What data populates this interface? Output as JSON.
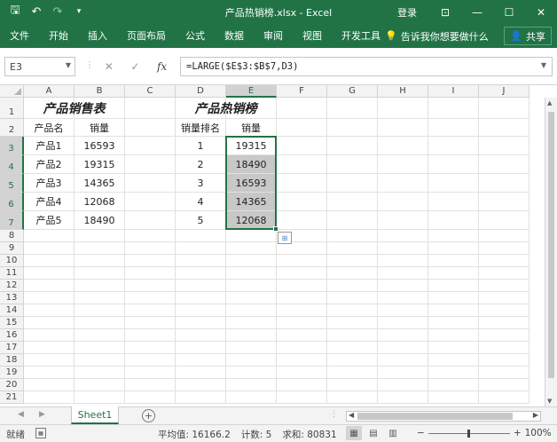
{
  "titlebar": {
    "title": "产品热销榜.xlsx - Excel",
    "login": "登录",
    "icons": [
      "save-icon",
      "undo-icon",
      "redo-icon",
      "customize-icon"
    ]
  },
  "ribbon": {
    "tabs": [
      "文件",
      "开始",
      "插入",
      "页面布局",
      "公式",
      "数据",
      "审阅",
      "视图",
      "开发工具"
    ],
    "tellme": "告诉我你想要做什么",
    "share": "共享"
  },
  "formula_bar": {
    "name_box": "E3",
    "formula": "=LARGE($E$3:$B$7,D3)"
  },
  "columns": [
    "A",
    "B",
    "C",
    "D",
    "E",
    "F",
    "G",
    "H",
    "I",
    "J"
  ],
  "rows": [
    "1",
    "2",
    "3",
    "4",
    "5",
    "6",
    "7",
    "8",
    "9",
    "10",
    "11",
    "12",
    "13",
    "14",
    "15",
    "16",
    "17",
    "18",
    "19",
    "20",
    "21"
  ],
  "sheet": {
    "left_title": "产品销售表",
    "right_title": "产品热销榜",
    "left_headers": [
      "产品名",
      "销量"
    ],
    "right_headers": [
      "销量排名",
      "销量"
    ],
    "left_rows": [
      [
        "产品1",
        "16593"
      ],
      [
        "产品2",
        "19315"
      ],
      [
        "产品3",
        "14365"
      ],
      [
        "产品4",
        "12068"
      ],
      [
        "产品5",
        "18490"
      ]
    ],
    "right_rows": [
      [
        "1",
        "19315"
      ],
      [
        "2",
        "18490"
      ],
      [
        "3",
        "16593"
      ],
      [
        "4",
        "14365"
      ],
      [
        "5",
        "12068"
      ]
    ]
  },
  "sheet_tabs": {
    "active": "Sheet1"
  },
  "statusbar": {
    "ready": "就绪",
    "average": "平均值: 16166.2",
    "count": "计数: 5",
    "sum": "求和: 80831",
    "zoom": "100%"
  }
}
